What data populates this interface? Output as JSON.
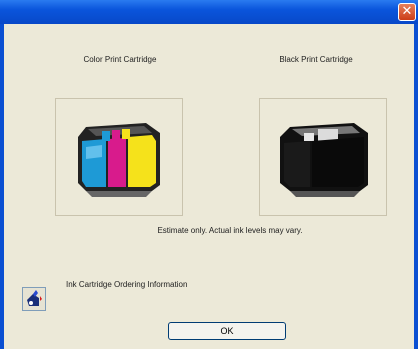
{
  "window": {
    "close_glyph": "✕"
  },
  "cartridges": {
    "color_label": "Color Print Cartridge",
    "black_label": "Black Print Cartridge",
    "color_icon": "color-cartridge-icon",
    "black_icon": "black-cartridge-icon"
  },
  "estimate_note": "Estimate only. Actual ink levels may vary.",
  "ordering": {
    "label": "Ink Cartridge Ordering Information",
    "icon": "ink-order-icon"
  },
  "buttons": {
    "ok": "OK"
  },
  "colors": {
    "titlebar": "#0a55dc",
    "dialog_bg": "#ece9d8",
    "cyan": "#1e9ad6",
    "magenta": "#d81b8c",
    "yellow": "#f5e21b",
    "black": "#111111"
  }
}
